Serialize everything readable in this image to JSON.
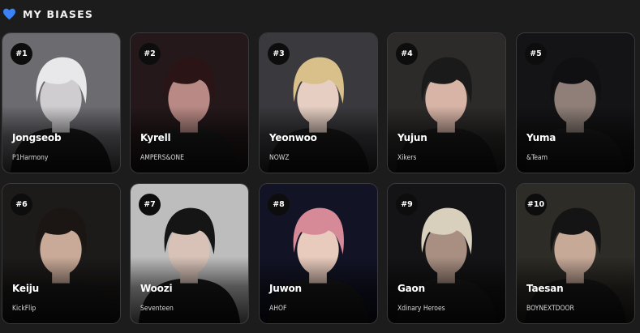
{
  "section": {
    "title": "MY BIASES",
    "heart_color": "#3b82f6"
  },
  "biases": [
    {
      "rank": "#1",
      "name": "Jongseob",
      "group": "P1Harmony",
      "hair": "#e8e8ea",
      "bg": "#6b6b70",
      "skin": "#cfcdcf"
    },
    {
      "rank": "#2",
      "name": "Kyrell",
      "group": "AMPERS&ONE",
      "hair": "#2a1416",
      "bg": "#24181a",
      "skin": "#b98a85"
    },
    {
      "rank": "#3",
      "name": "Yeonwoo",
      "group": "NOWZ",
      "hair": "#d9c08a",
      "bg": "#3a3a3e",
      "skin": "#e6cfc2"
    },
    {
      "rank": "#4",
      "name": "Yujun",
      "group": "Xikers",
      "hair": "#1a1a1a",
      "bg": "#2d2b2a",
      "skin": "#d7b4a6"
    },
    {
      "rank": "#5",
      "name": "Yuma",
      "group": "&Team",
      "hair": "#101012",
      "bg": "#141416",
      "skin": "#8f7f78"
    },
    {
      "rank": "#6",
      "name": "Keiju",
      "group": "KickFlip",
      "hair": "#1b1513",
      "bg": "#1d1b1a",
      "skin": "#c9aa98"
    },
    {
      "rank": "#7",
      "name": "Woozi",
      "group": "Seventeen",
      "hair": "#151515",
      "bg": "#bdbdbd",
      "skin": "#d8c2b8"
    },
    {
      "rank": "#8",
      "name": "Juwon",
      "group": "AHOF",
      "hair": "#d68a98",
      "bg": "#121426",
      "skin": "#e8cbbd"
    },
    {
      "rank": "#9",
      "name": "Gaon",
      "group": "Xdinary Heroes",
      "hair": "#d8cfbd",
      "bg": "#141416",
      "skin": "#a98f82"
    },
    {
      "rank": "#10",
      "name": "Taesan",
      "group": "BOYNEXTDOOR",
      "hair": "#141414",
      "bg": "#2e2c26",
      "skin": "#c7a998"
    }
  ]
}
